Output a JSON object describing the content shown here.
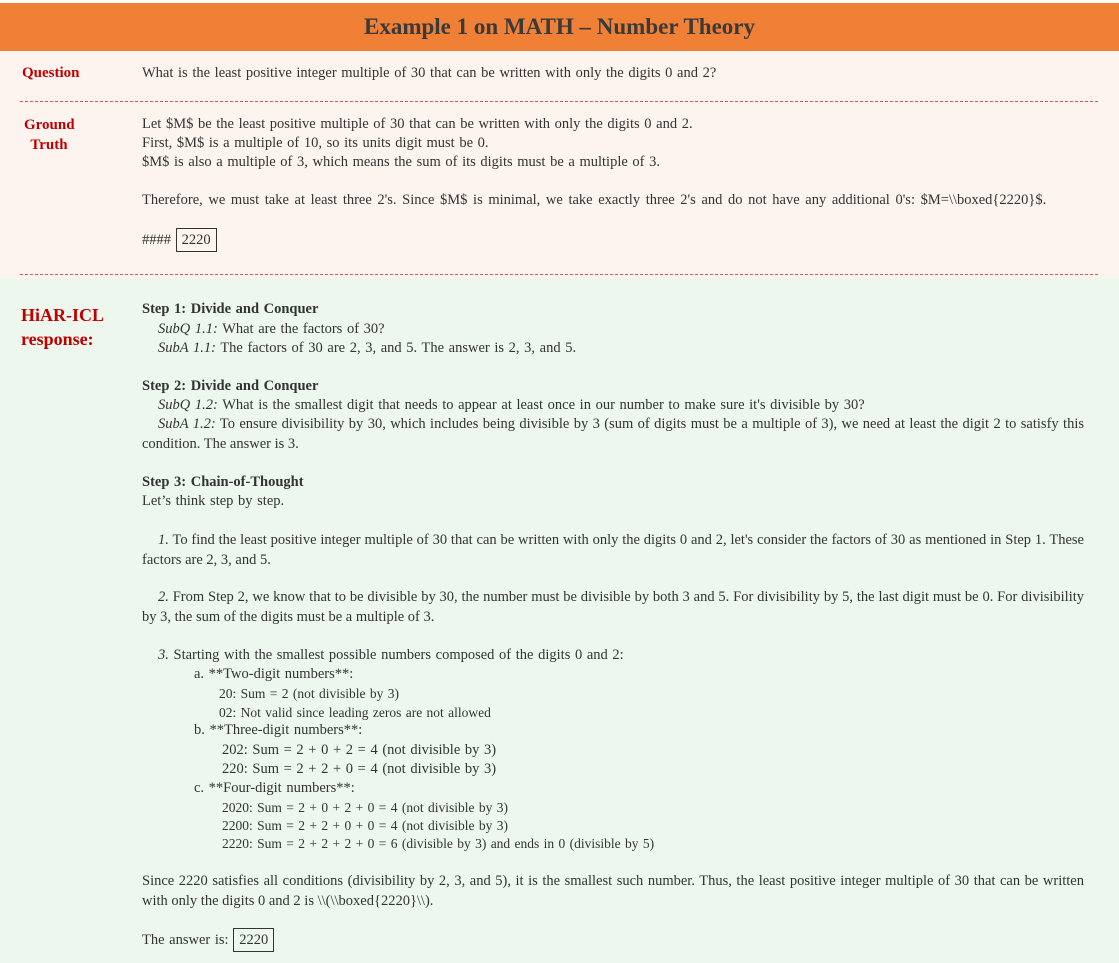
{
  "title": "Example 1 on MATH – Number Theory",
  "labels": {
    "question": "Question",
    "ground_truth_1": "Ground",
    "ground_truth_2": "Truth",
    "response_1": "HiAR-ICL",
    "response_2": "response:"
  },
  "question": "What is the least positive integer multiple of 30 that can be written with only the digits 0 and 2?",
  "ground_truth": {
    "line1": "Let $M$ be the least positive multiple of 30 that can be written with only the digits 0 and 2.",
    "line2": "First, $M$ is a multiple of 10, so its units digit must be 0.",
    "line3": "$M$ is also a multiple of 3, which means the sum of its digits must be a multiple of 3.",
    "line4": "Therefore, we must take at least three 2's. Since $M$ is minimal, we take exactly three 2's and do not have any additional 0's: $M=\\\\boxed{2220}$.",
    "answer_prefix": "####",
    "answer": "2220"
  },
  "response": {
    "step1_title": "Step 1: Divide and Conquer",
    "step1_subq_label": "SubQ 1.1:",
    "step1_subq": "What are the factors of 30?",
    "step1_suba_label": "SubA 1.1:",
    "step1_suba": "The factors of 30 are 2, 3, and 5. The answer is 2, 3, and 5.",
    "step2_title": "Step 2: Divide and Conquer",
    "step2_subq_label": "SubQ 1.2:",
    "step2_subq": "What is the smallest digit that needs to appear at least once in our number to make sure it's divisible by 30?",
    "step2_suba_label": "SubA 1.2:",
    "step2_suba": "To ensure divisibility by 30, which includes being divisible by 3 (sum of digits must be a multiple of 3), we need at least the digit 2 to satisfy this condition. The answer is 3.",
    "step3_title": "Step 3: Chain-of-Thought",
    "step3_intro": "Let’s think step by step.",
    "p1_num": "1.",
    "p1": "To find the least positive integer multiple of 30 that can be written with only the digits 0 and 2, let's consider the factors of 30 as mentioned in Step 1. These factors are 2, 3, and 5.",
    "p2_num": "2.",
    "p2": "From Step 2, we know that to be divisible by 30, the number must be divisible by both 3 and 5. For divisibility by 5, the last digit must be 0. For divisibility by 3, the sum of the digits must be a multiple of 3.",
    "p3_num": "3.",
    "p3": "Starting with the smallest possible numbers composed of the digits 0 and 2:",
    "a": "a. **Two-digit numbers**:",
    "a1": "20: Sum = 2 (not divisible by 3)",
    "a2": "02: Not valid since leading zeros are not allowed",
    "b": "b. **Three-digit numbers**:",
    "b1": "202: Sum = 2 + 0 + 2 = 4 (not divisible by 3)",
    "b2": "220: Sum = 2 + 2 + 0 = 4 (not divisible by 3)",
    "c": "c. **Four-digit numbers**:",
    "c1": "2020: Sum = 2 + 0 + 2 + 0 = 4 (not divisible by 3)",
    "c2": "2200: Sum = 2 + 2 + 0 + 0 = 4 (not divisible by 3)",
    "c3": "2220: Sum = 2 + 2 + 2 + 0 = 6 (divisible by 3) and ends in 0 (divisible by 5)",
    "conclusion": "Since 2220 satisfies all conditions (divisibility by 2, 3, and 5), it is the smallest such number. Thus, the least positive integer multiple of 30 that can be written with only the digits 0 and 2 is \\\\(\\\\boxed{2220}\\\\).",
    "answer_prefix": "The answer is:",
    "answer": "2220"
  }
}
